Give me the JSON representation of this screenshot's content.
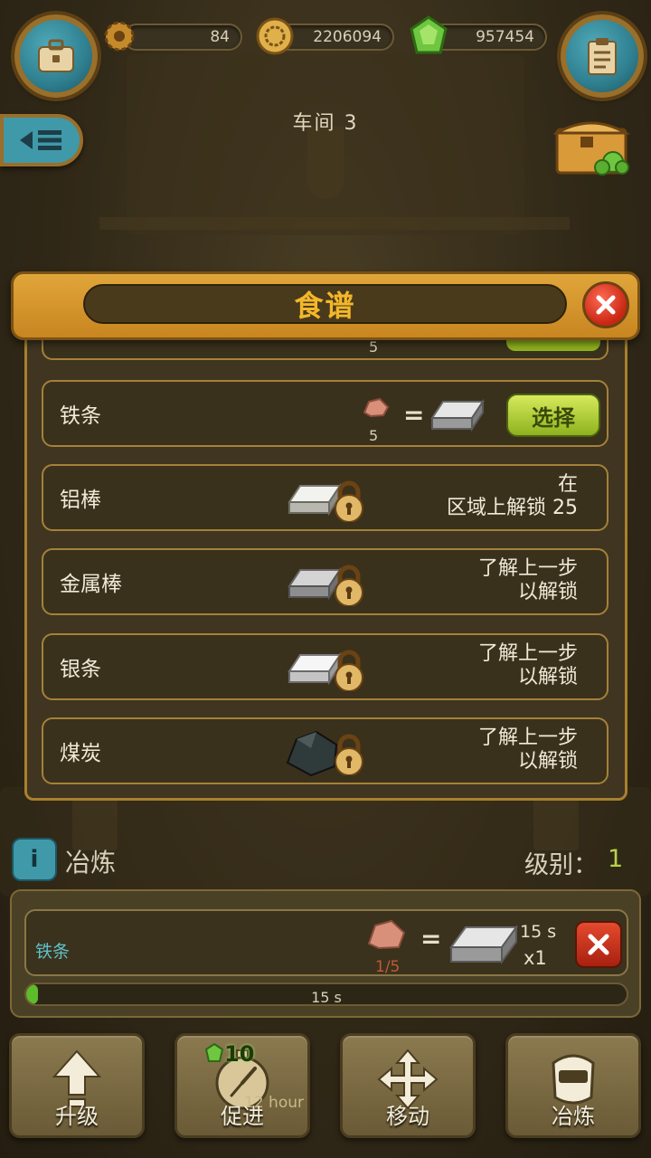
{
  "top_bar": {
    "gear_count": "84",
    "coin_count": "2206094",
    "gem_count": "957454"
  },
  "workshop": {
    "title": "车间 3"
  },
  "recipe_panel": {
    "title": "食谱",
    "partial_row_qty": "5",
    "rows": [
      {
        "name": "铁条",
        "input_qty": "5",
        "select_label": "选择"
      },
      {
        "name": "铝棒",
        "unlock_line1": "在",
        "unlock_line2": "区域上解锁 25"
      },
      {
        "name": "金属棒",
        "unlock_line1": "了解上一步",
        "unlock_line2": "以解锁"
      },
      {
        "name": "银条",
        "unlock_line1": "了解上一步",
        "unlock_line2": "以解锁"
      },
      {
        "name": "煤炭",
        "unlock_line1": "了解上一步",
        "unlock_line2": "以解锁"
      }
    ]
  },
  "smelting": {
    "info_label": "i",
    "title": "冶炼",
    "level_label": "级别：",
    "level_value": "1",
    "queue_item": {
      "name": "铁条",
      "input_count": "1/5",
      "duration": "15 s",
      "multiplier": "x1"
    },
    "progress_text": "15 s",
    "progress_fraction": 0.02
  },
  "toolbar": {
    "upgrade_label": "升级",
    "boost_label": "促进",
    "boost_cost": "10",
    "boost_duration": "12 hour",
    "move_label": "移动",
    "smelt_label": "冶炼"
  },
  "colors": {
    "accent_teal": "#3f99a8",
    "panel_gold": "#e0a63a",
    "title_gold": "#f3b72a",
    "select_green": "#b8d24a",
    "close_red": "#c82612"
  }
}
